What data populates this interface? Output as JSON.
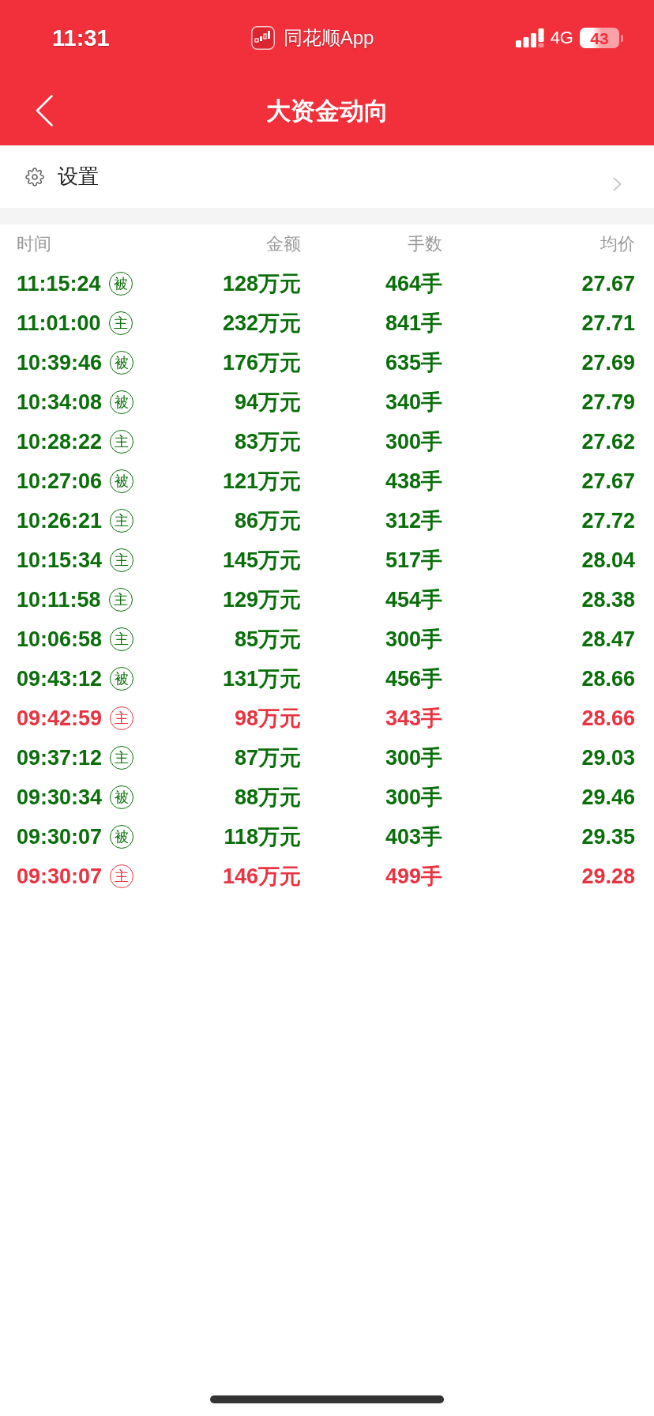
{
  "status_bar": {
    "time": "11:31",
    "app_name": "同花顺App",
    "network": "4G",
    "battery": "43"
  },
  "header": {
    "title": "大资金动向"
  },
  "settings": {
    "label": "设置"
  },
  "table": {
    "columns": [
      "时间",
      "金额",
      "手数",
      "均价"
    ],
    "rows": [
      {
        "time": "11:15:24",
        "tag": "被",
        "amount": "128万元",
        "lots": "464手",
        "price": "27.67",
        "color": "#0a6e0a"
      },
      {
        "time": "11:01:00",
        "tag": "主",
        "amount": "232万元",
        "lots": "841手",
        "price": "27.71",
        "color": "#0a6e0a"
      },
      {
        "time": "10:39:46",
        "tag": "被",
        "amount": "176万元",
        "lots": "635手",
        "price": "27.69",
        "color": "#0a6e0a"
      },
      {
        "time": "10:34:08",
        "tag": "被",
        "amount": "94万元",
        "lots": "340手",
        "price": "27.79",
        "color": "#0a6e0a"
      },
      {
        "time": "10:28:22",
        "tag": "主",
        "amount": "83万元",
        "lots": "300手",
        "price": "27.62",
        "color": "#0a6e0a"
      },
      {
        "time": "10:27:06",
        "tag": "被",
        "amount": "121万元",
        "lots": "438手",
        "price": "27.67",
        "color": "#0a6e0a"
      },
      {
        "time": "10:26:21",
        "tag": "主",
        "amount": "86万元",
        "lots": "312手",
        "price": "27.72",
        "color": "#0a6e0a"
      },
      {
        "time": "10:15:34",
        "tag": "主",
        "amount": "145万元",
        "lots": "517手",
        "price": "28.04",
        "color": "#0a6e0a"
      },
      {
        "time": "10:11:58",
        "tag": "主",
        "amount": "129万元",
        "lots": "454手",
        "price": "28.38",
        "color": "#0a6e0a"
      },
      {
        "time": "10:06:58",
        "tag": "主",
        "amount": "85万元",
        "lots": "300手",
        "price": "28.47",
        "color": "#0a6e0a"
      },
      {
        "time": "09:43:12",
        "tag": "被",
        "amount": "131万元",
        "lots": "456手",
        "price": "28.66",
        "color": "#0a6e0a"
      },
      {
        "time": "09:42:59",
        "tag": "主",
        "amount": "98万元",
        "lots": "343手",
        "price": "28.66",
        "color": "#ea3340"
      },
      {
        "time": "09:37:12",
        "tag": "主",
        "amount": "87万元",
        "lots": "300手",
        "price": "29.03",
        "color": "#0a6e0a"
      },
      {
        "time": "09:30:34",
        "tag": "被",
        "amount": "88万元",
        "lots": "300手",
        "price": "29.46",
        "color": "#0a6e0a"
      },
      {
        "time": "09:30:07",
        "tag": "被",
        "amount": "118万元",
        "lots": "403手",
        "price": "29.35",
        "color": "#0a6e0a"
      },
      {
        "time": "09:30:07",
        "tag": "主",
        "amount": "146万元",
        "lots": "499手",
        "price": "29.28",
        "color": "#ea3340"
      }
    ]
  }
}
